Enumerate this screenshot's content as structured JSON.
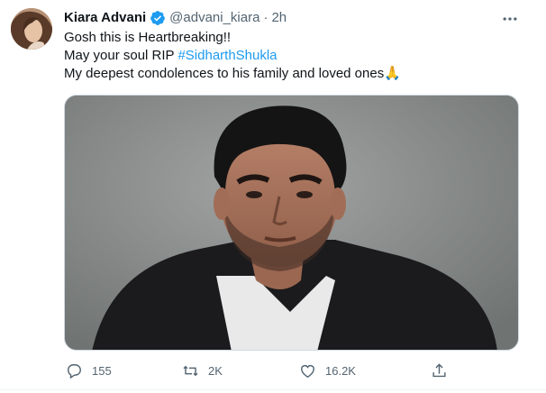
{
  "author": {
    "name": "Kiara Advani",
    "handle": "@advani_kiara",
    "separator": "·",
    "time": "2h",
    "verified": true
  },
  "tweet": {
    "line1": "Gosh this is Heartbreaking!!",
    "line2_prefix": "May your soul RIP ",
    "line2_hashtag": "#SidharthShukla",
    "line3": "My deepest condolences to his family and loved ones",
    "line3_emoji": "🙏"
  },
  "actions": {
    "replies": "155",
    "retweets": "2K",
    "likes": "16.2K"
  },
  "icons": {
    "more": "more-horizontal-icon",
    "verified": "verified-badge-icon",
    "reply": "reply-icon",
    "retweet": "retweet-icon",
    "like": "heart-icon",
    "share": "share-icon"
  },
  "colors": {
    "accent": "#1d9bf0",
    "secondary_text": "#536471",
    "primary_text": "#0f1419",
    "photo_background": "#8b8f8f"
  }
}
